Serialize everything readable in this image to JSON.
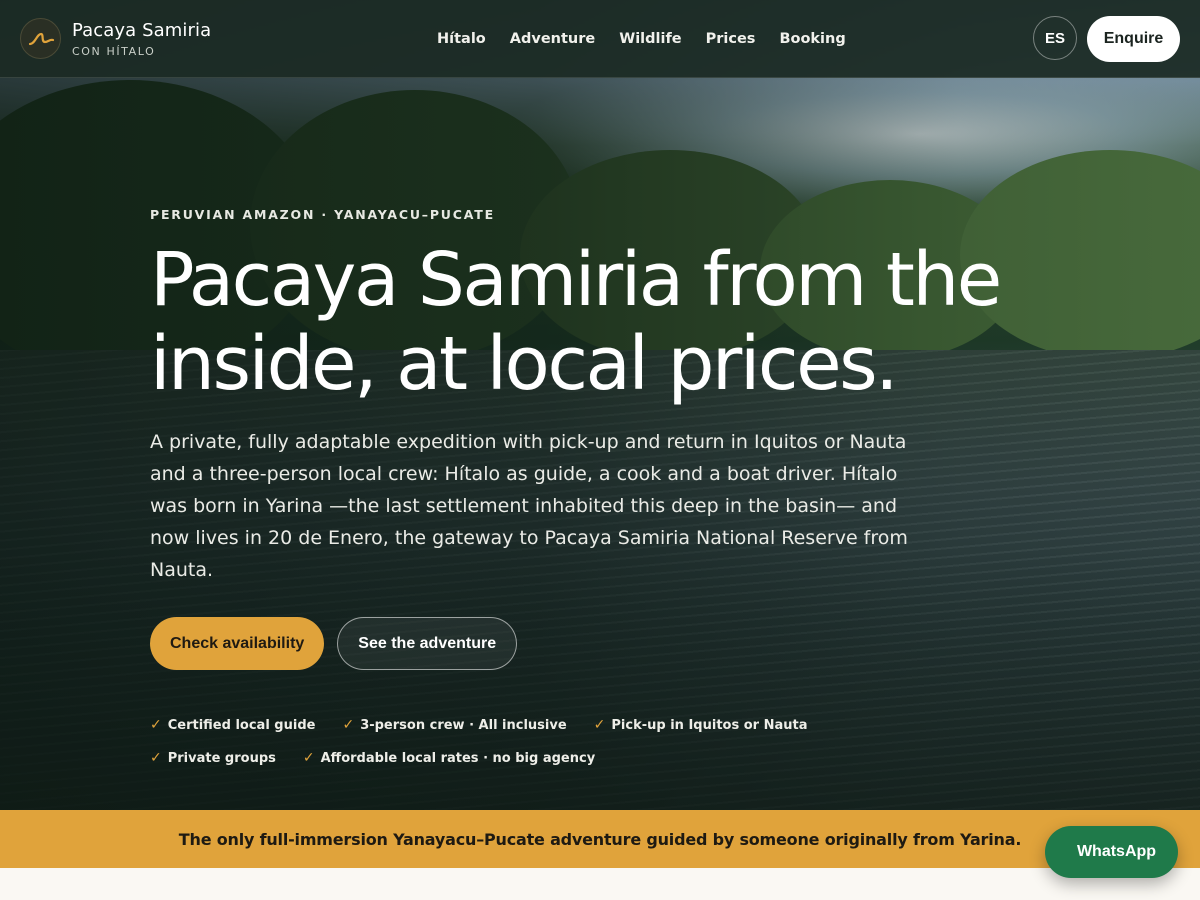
{
  "brand": {
    "title": "Pacaya Samiria",
    "subtitle": "CON HÍTALO",
    "logo_icon": "river-swoosh-icon",
    "accent_color": "#e0a33b"
  },
  "nav": {
    "items": [
      {
        "label": "Hítalo"
      },
      {
        "label": "Adventure"
      },
      {
        "label": "Wildlife"
      },
      {
        "label": "Prices"
      },
      {
        "label": "Booking"
      }
    ],
    "language_label": "ES",
    "enquire_label": "Enquire"
  },
  "hero": {
    "eyebrow": "PERUVIAN AMAZON · YANAYACU–PUCATE",
    "title_line1": "Pacaya Samiria from the",
    "title_line2": "inside, at local prices.",
    "lead": "A private, fully adaptable expedition with pick-up and return in Iquitos or Nauta and a three-person local crew: Hítalo as guide, a cook and a boat driver. Hítalo was born in Yarina —the last settlement inhabited this deep in the basin— and now lives in 20 de Enero, the gateway to Pacaya Samiria National Reserve from Nauta.",
    "primary_cta": "Check availability",
    "secondary_cta": "See the adventure",
    "checks": [
      {
        "mark": "✓",
        "label": "Certified local guide"
      },
      {
        "mark": "✓",
        "label": "3-person crew · All inclusive"
      },
      {
        "mark": "✓",
        "label": "Pick-up in Iquitos or Nauta"
      },
      {
        "mark": "✓",
        "label": "Private groups"
      },
      {
        "mark": "✓",
        "label": "Affordable local rates · no big agency"
      }
    ]
  },
  "banner": {
    "text": "The only full-immersion Yanayacu–Pucate adventure guided by someone originally from Yarina."
  },
  "whatsapp": {
    "label": "WhatsApp",
    "color": "#1f7a4a"
  }
}
